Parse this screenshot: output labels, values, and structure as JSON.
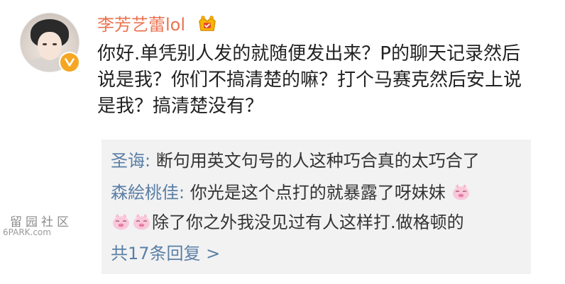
{
  "post": {
    "author": "李芳艺蕾lol",
    "text": "你好.单凭别人发的就随便发出来？P的聊天记录然后说是我？你们不搞清楚的嘛？打个马赛克然后安上说是我？搞清楚没有？",
    "author_color": "#eb7350",
    "icons": {
      "avatar": "user-avatar",
      "verified": "verified-badge-icon",
      "member": "crown-member-icon"
    }
  },
  "comments": {
    "items": [
      {
        "user": "圣诲",
        "sep": ": ",
        "text": "断句用英文句号的人这种巧合真的太巧合了"
      },
      {
        "user": "森絵桃佳",
        "sep": ": ",
        "text": "你光是这个点打的就暴露了呀妹妹",
        "text_cont": "除了你之外我没见过有人这样打.做格顿的"
      }
    ],
    "more_link": "共17条回复 >",
    "link_color": "#5b7fa6",
    "background": "#f2f2f2"
  },
  "watermark": {
    "top": "留园社区",
    "bottom": "6PARK.com"
  }
}
